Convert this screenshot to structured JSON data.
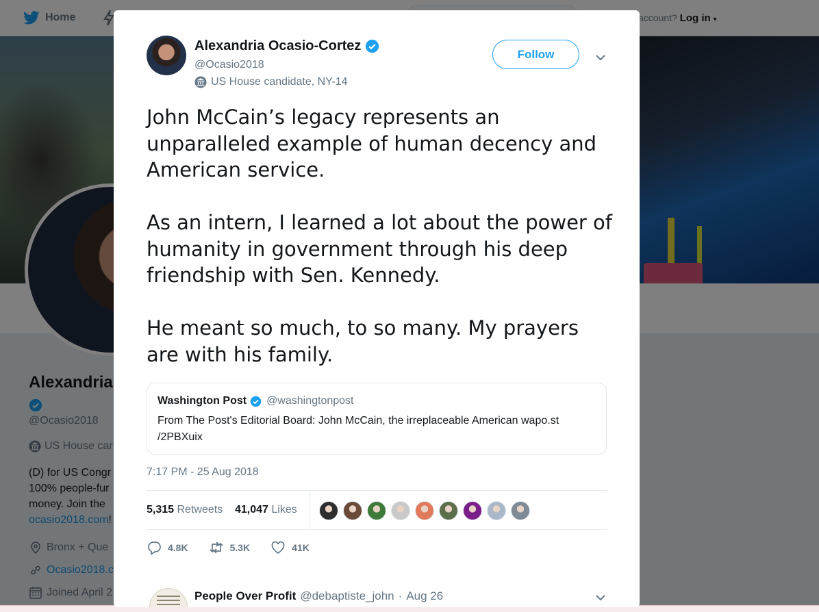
{
  "topnav": {
    "home_label": "Home",
    "login_prefix": "account?",
    "login_label": "Log in"
  },
  "profile": {
    "name": "Alexandria",
    "handle": "@Ocasio2018",
    "candidate_label": "US House car",
    "bio_lines": [
      "(D) for US Congr",
      "100% people-fur",
      "money. Join the"
    ],
    "bio_link": "ocasio2018.com",
    "bio_link_suffix": "!",
    "location": "Bronx + Que",
    "website": "Ocasio2018.c",
    "joined": "Joined April 2"
  },
  "modal": {
    "author": {
      "name": "Alexandria Ocasio-Cortez",
      "handle": "@Ocasio2018",
      "label": "US House candidate, NY-14"
    },
    "follow_label": "Follow",
    "tweet_paragraphs": [
      "John McCain’s legacy represents an unparalleled example of human decency and American service.",
      "As an intern, I learned a lot about the power of humanity in government through his deep friendship with Sen. Kennedy.",
      "He meant so much, to so many. My prayers are with his family."
    ],
    "quote": {
      "name": "Washington Post",
      "handle": "@washingtonpost",
      "text": "From The Post's Editorial Board: John McCain, the irreplaceable American wapo.st /2PBXuix"
    },
    "timestamp": "7:17 PM - 25 Aug 2018",
    "stats": {
      "retweets_count": "5,315",
      "retweets_label": "Retweets",
      "likes_count": "41,047",
      "likes_label": "Likes"
    },
    "liker_colors": [
      "#2d2d2d",
      "#6b4a3a",
      "#3f7a3a",
      "#c9c9c9",
      "#e07a5a",
      "#5d6e4a",
      "#7a1f8a",
      "#a9b7c9",
      "#7e8a96"
    ],
    "actions": {
      "replies": "4.8K",
      "retweets": "5.3K",
      "likes": "41K"
    },
    "reply": {
      "name": "People Over Profit",
      "handle": "@debaptiste_john",
      "date": "Aug 26"
    }
  },
  "colors": {
    "accent": "#1da1f2",
    "verified": "#1da1f2",
    "text_secondary": "#657786"
  }
}
